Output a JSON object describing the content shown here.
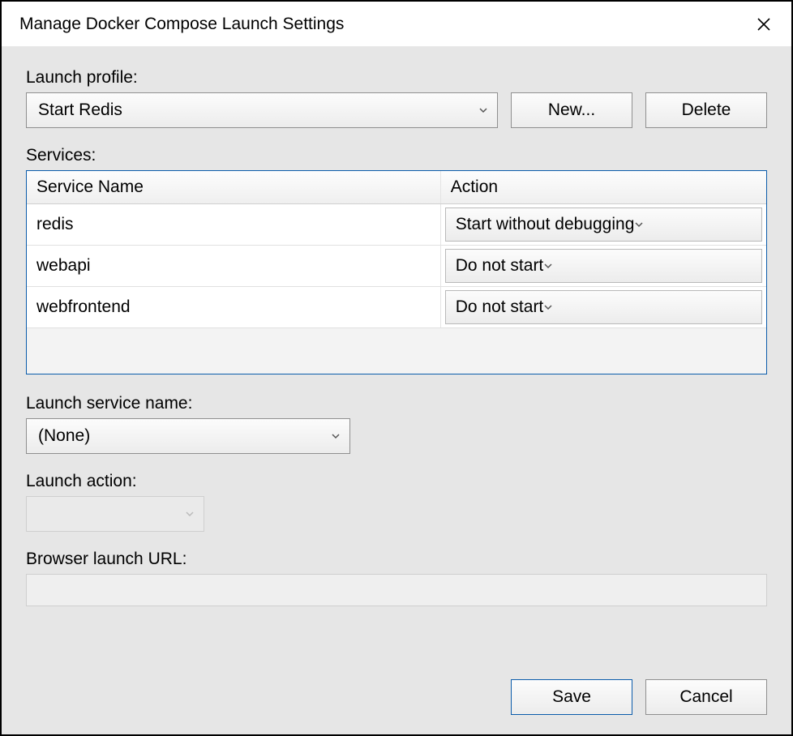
{
  "title": "Manage Docker Compose Launch Settings",
  "labels": {
    "launchProfile": "Launch profile:",
    "services": "Services:",
    "launchServiceName": "Launch service name:",
    "launchAction": "Launch action:",
    "browserLaunchUrl": "Browser launch URL:"
  },
  "profile": {
    "selected": "Start Redis",
    "newLabel": "New...",
    "deleteLabel": "Delete"
  },
  "servicesTable": {
    "headers": {
      "name": "Service Name",
      "action": "Action"
    },
    "rows": [
      {
        "name": "redis",
        "action": "Start without debugging"
      },
      {
        "name": "webapi",
        "action": "Do not start"
      },
      {
        "name": "webfrontend",
        "action": "Do not start"
      }
    ]
  },
  "launchServiceName": "(None)",
  "launchAction": "",
  "browserLaunchUrl": "",
  "footer": {
    "save": "Save",
    "cancel": "Cancel"
  }
}
